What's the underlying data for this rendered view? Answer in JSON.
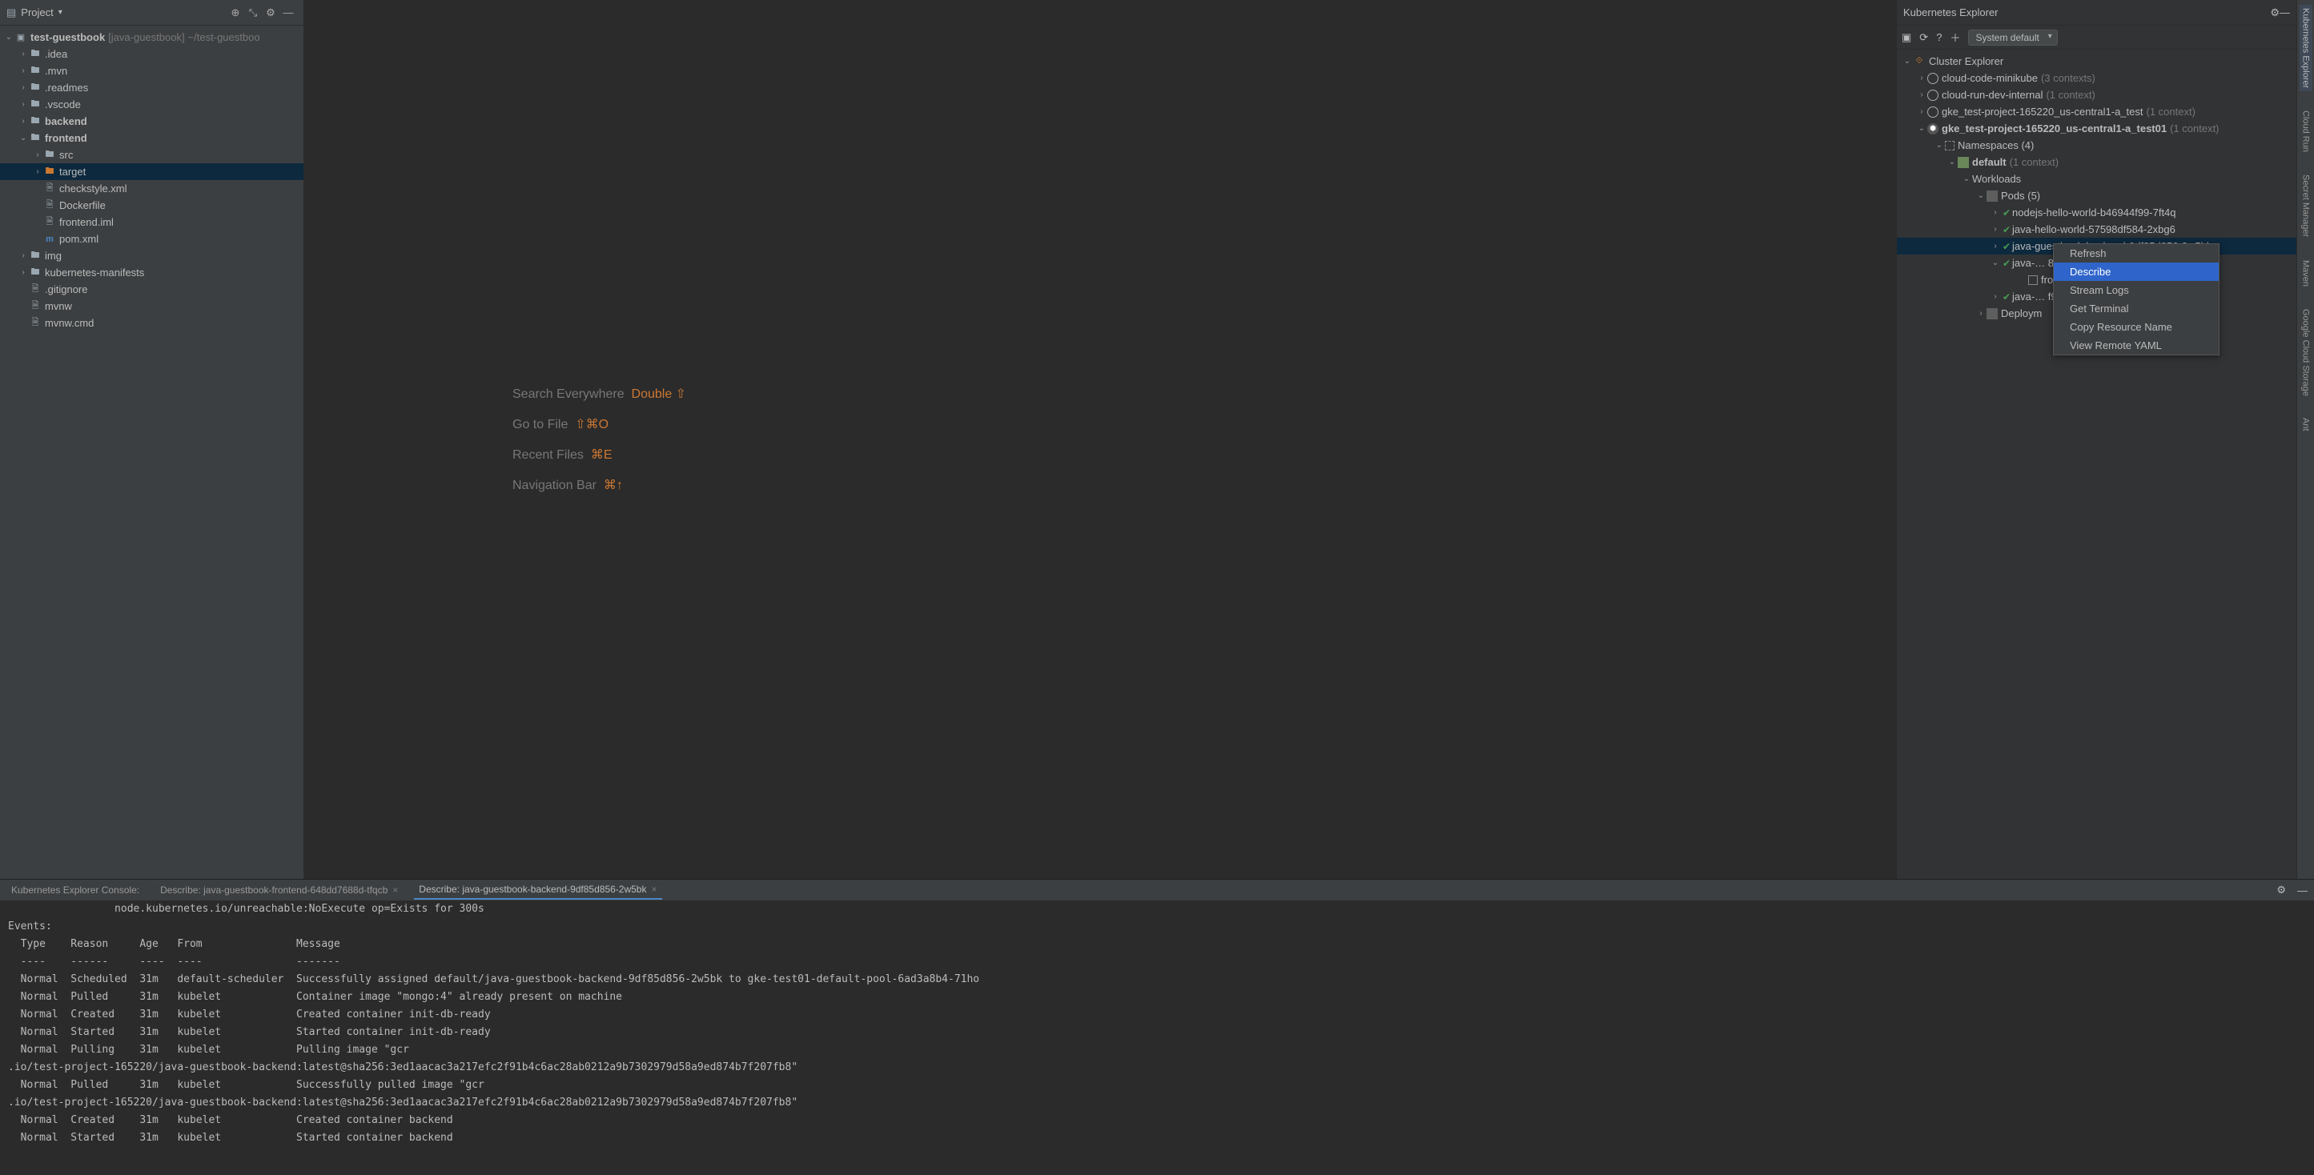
{
  "project_panel": {
    "title": "Project",
    "root": {
      "name": "test-guestbook",
      "hint": "[java-guestbook]",
      "path": "~/test-guestboo"
    },
    "items": [
      {
        "indent": 1,
        "arrow": "›",
        "icon": "folder",
        "label": ".idea"
      },
      {
        "indent": 1,
        "arrow": "›",
        "icon": "folder",
        "label": ".mvn"
      },
      {
        "indent": 1,
        "arrow": "›",
        "icon": "folder",
        "label": ".readmes"
      },
      {
        "indent": 1,
        "arrow": "›",
        "icon": "folder",
        "label": ".vscode"
      },
      {
        "indent": 1,
        "arrow": "›",
        "icon": "folder-b",
        "label": "backend",
        "bold": true
      },
      {
        "indent": 1,
        "arrow": "⌄",
        "icon": "folder-b",
        "label": "frontend",
        "bold": true
      },
      {
        "indent": 2,
        "arrow": "›",
        "icon": "folder-b",
        "label": "src"
      },
      {
        "indent": 2,
        "arrow": "›",
        "icon": "folder-o",
        "label": "target",
        "sel": true
      },
      {
        "indent": 2,
        "arrow": "",
        "icon": "file",
        "label": "checkstyle.xml"
      },
      {
        "indent": 2,
        "arrow": "",
        "icon": "file",
        "label": "Dockerfile"
      },
      {
        "indent": 2,
        "arrow": "",
        "icon": "file",
        "label": "frontend.iml"
      },
      {
        "indent": 2,
        "arrow": "",
        "icon": "file-m",
        "label": "pom.xml"
      },
      {
        "indent": 1,
        "arrow": "›",
        "icon": "folder",
        "label": "img"
      },
      {
        "indent": 1,
        "arrow": "›",
        "icon": "folder",
        "label": "kubernetes-manifests"
      },
      {
        "indent": 1,
        "arrow": "",
        "icon": "file",
        "label": ".gitignore"
      },
      {
        "indent": 1,
        "arrow": "",
        "icon": "file",
        "label": "mvnw"
      },
      {
        "indent": 1,
        "arrow": "",
        "icon": "file",
        "label": "mvnw.cmd"
      }
    ]
  },
  "welcome": {
    "rows": [
      {
        "label": "Search Everywhere",
        "kb": "Double ⇧"
      },
      {
        "label": "Go to File",
        "kb": "⇧⌘O"
      },
      {
        "label": "Recent Files",
        "kb": "⌘E"
      },
      {
        "label": "Navigation Bar",
        "kb": "⌘↑"
      }
    ]
  },
  "k8s_panel": {
    "title": "Kubernetes Explorer",
    "select": "System default",
    "root": "Cluster Explorer",
    "clusters": [
      {
        "name": "cloud-code-minikube",
        "ctx": "(3 contexts)",
        "icon": "circle",
        "arrow": "›"
      },
      {
        "name": "cloud-run-dev-internal",
        "ctx": "(1 context)",
        "icon": "circle",
        "arrow": "›"
      },
      {
        "name": "gke_test-project-165220_us-central1-a_test",
        "ctx": "(1 context)",
        "icon": "circle",
        "arrow": "›"
      },
      {
        "name": "gke_test-project-165220_us-central1-a_test01",
        "ctx": "(1 context)",
        "icon": "gke",
        "arrow": "⌄",
        "bold": true
      }
    ],
    "namespaces_label": "Namespaces (4)",
    "default_ns": {
      "label": "default",
      "ctx": "(1 context)"
    },
    "workloads_label": "Workloads",
    "pods_label": "Pods (5)",
    "pods": [
      {
        "arrow": "›",
        "name": "nodejs-hello-world-b46944f99-7ft4q"
      },
      {
        "arrow": "›",
        "name": "java-hello-world-57598df584-2xbg6"
      },
      {
        "arrow": "›",
        "name": "java-guestbook-backend-9df85d856-2w5bk",
        "sel": true
      },
      {
        "arrow": "⌄",
        "name": "java-…                                       8d-tfqcb"
      },
      {
        "arrow": "",
        "name": "fro",
        "child": true
      },
      {
        "arrow": "›",
        "name": "java-…                                     f9-4v2j8"
      }
    ],
    "deployments": "Deploym",
    "context_menu": {
      "items": [
        "Refresh",
        "Describe",
        "Stream Logs",
        "Get Terminal",
        "Copy Resource Name",
        "View Remote YAML"
      ],
      "highlighted": 1
    }
  },
  "right_tabs": [
    "Kubernetes Explorer",
    "Cloud Run",
    "Secret Manager",
    "Maven",
    "Google Cloud Storage",
    "Ant"
  ],
  "bottom": {
    "tabs": [
      {
        "label": "Kubernetes Explorer Console:",
        "closable": false
      },
      {
        "label": "Describe: java-guestbook-frontend-648dd7688d-tfqcb",
        "closable": true
      },
      {
        "label": "Describe: java-guestbook-backend-9df85d856-2w5bk",
        "closable": true,
        "active": true
      }
    ],
    "console": "                 node.kubernetes.io/unreachable:NoExecute op=Exists for 300s\nEvents:\n  Type    Reason     Age   From               Message\n  ----    ------     ----  ----               -------\n  Normal  Scheduled  31m   default-scheduler  Successfully assigned default/java-guestbook-backend-9df85d856-2w5bk to gke-test01-default-pool-6ad3a8b4-71ho\n  Normal  Pulled     31m   kubelet            Container image \"mongo:4\" already present on machine\n  Normal  Created    31m   kubelet            Created container init-db-ready\n  Normal  Started    31m   kubelet            Started container init-db-ready\n  Normal  Pulling    31m   kubelet            Pulling image \"gcr\n.io/test-project-165220/java-guestbook-backend:latest@sha256:3ed1aacac3a217efc2f91b4c6ac28ab0212a9b7302979d58a9ed874b7f207fb8\"\n  Normal  Pulled     31m   kubelet            Successfully pulled image \"gcr\n.io/test-project-165220/java-guestbook-backend:latest@sha256:3ed1aacac3a217efc2f91b4c6ac28ab0212a9b7302979d58a9ed874b7f207fb8\"\n  Normal  Created    31m   kubelet            Created container backend\n  Normal  Started    31m   kubelet            Started container backend"
  }
}
